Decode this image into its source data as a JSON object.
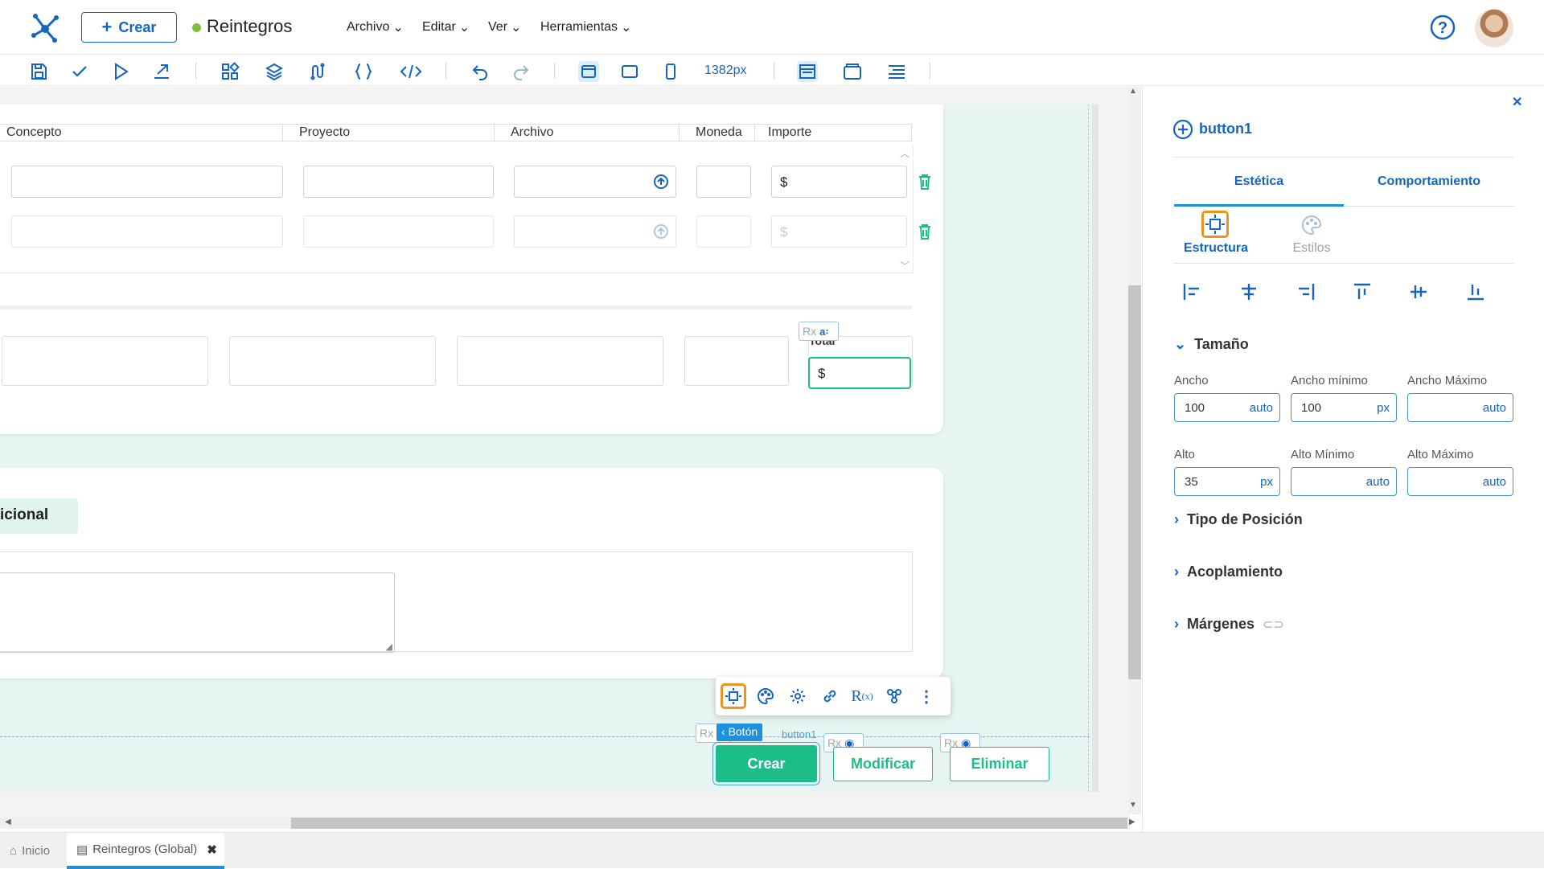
{
  "header": {
    "create_label": "Crear",
    "app_title": "Reintegros",
    "menus": [
      "Archivo",
      "Editar",
      "Ver",
      "Herramientas"
    ],
    "status_color": "#7cbf3a"
  },
  "toolbar": {
    "icons": [
      "save-icon",
      "check-icon",
      "play-icon",
      "export-icon",
      "components-icon",
      "layers-icon",
      "data-icon",
      "braces-icon",
      "code-icon",
      "undo-icon",
      "redo-icon",
      "desktop-view-icon",
      "tablet-view-icon",
      "mobile-view-icon",
      "layout-icon",
      "window-icon",
      "alignment-icon"
    ],
    "zoom": "1382px"
  },
  "grid": {
    "headers": [
      "Concepto",
      "Proyecto",
      "Archivo",
      "Moneda",
      "Importe"
    ],
    "currency_symbol": "$",
    "total_label": "Total",
    "total_value": "$"
  },
  "section2": {
    "tab_label": "icional"
  },
  "buttons": {
    "create": "Crear",
    "modify": "Modificar",
    "delete": "Eliminar",
    "component_name": "button1",
    "breadcrumb": "Botón",
    "rx": "Rx"
  },
  "panel": {
    "component_title": "button1",
    "tabs": [
      "Estética",
      "Comportamiento"
    ],
    "subtabs": [
      "Estructura",
      "Estilos"
    ],
    "size_section": "Tamaño",
    "labels": {
      "ancho": "Ancho",
      "ancho_min": "Ancho mínimo",
      "ancho_max": "Ancho Máximo",
      "alto": "Alto",
      "alto_min": "Alto Mínimo",
      "alto_max": "Alto Máximo"
    },
    "values": {
      "ancho": "100",
      "ancho_unit": "auto",
      "ancho_min": "100",
      "ancho_min_unit": "px",
      "ancho_max_unit": "auto",
      "alto": "35",
      "alto_unit": "px",
      "alto_min_unit": "auto",
      "alto_max_unit": "auto"
    },
    "sections": [
      "Tipo de Posición",
      "Acoplamiento",
      "Márgenes"
    ]
  },
  "bottom_tabs": {
    "home": "Inicio",
    "current": "Reintegros (Global)"
  },
  "colors": {
    "primary": "#1565c0",
    "accent_green": "#1dbd8a",
    "highlight_orange": "#f0931e"
  }
}
